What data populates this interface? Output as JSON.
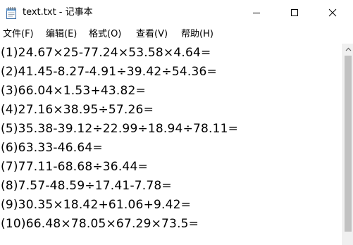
{
  "window": {
    "title": "text.txt - 记事本",
    "controls": {
      "minimize": "—",
      "maximize": "☐",
      "close": "✕"
    }
  },
  "menu": [
    {
      "label": "文件(F)"
    },
    {
      "label": "编辑(E)"
    },
    {
      "label": "格式(O)"
    },
    {
      "label": "查看(V)"
    },
    {
      "label": "帮助(H)"
    }
  ],
  "document": {
    "lines": [
      "(1)24.67×25-77.24×53.58×4.64=",
      "(2)41.45-8.27-4.91÷39.42÷54.36=",
      "(3)66.04×1.53+43.82=",
      "(4)27.16×38.95÷57.26=",
      "(5)35.38-39.12÷22.99÷18.94÷78.11=",
      "(6)63.33-46.64=",
      "(7)77.11-68.68÷36.44=",
      "(8)7.57-48.59÷17.41-7.78=",
      "(9)30.35×18.42+61.06+9.42=",
      "(10)66.48×78.05×67.29×73.5="
    ]
  },
  "colors": {
    "background": "#ffffff",
    "text": "#000000",
    "scrollbar_track": "#f0f0f0",
    "scrollbar_thumb": "#c1c1c1"
  }
}
